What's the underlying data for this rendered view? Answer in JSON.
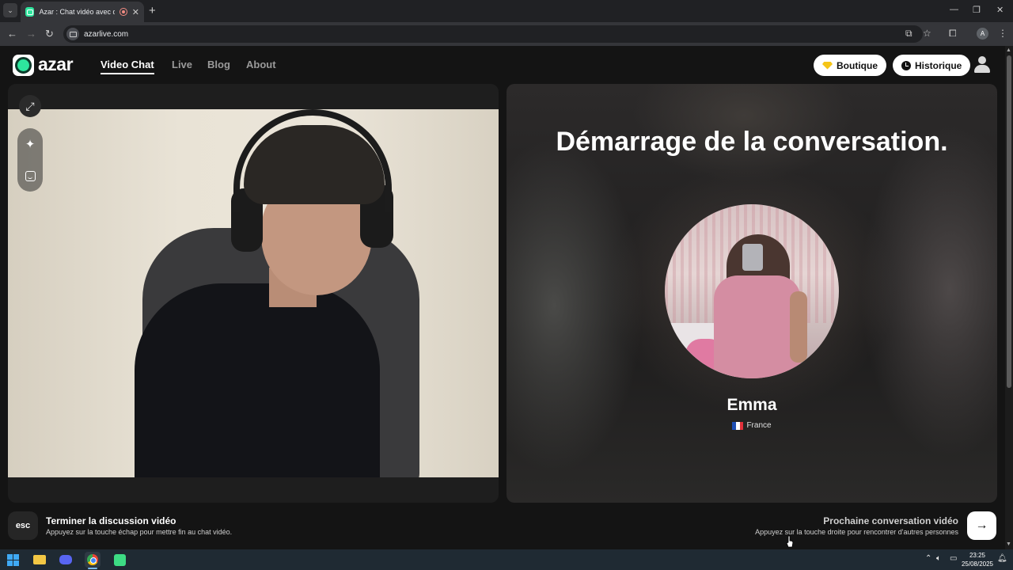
{
  "browser": {
    "tab_title": "Azar : Chat vidéo avec de nouvelles personnes",
    "url": "azarlive.com",
    "profile_initial": "A"
  },
  "header": {
    "logo_text": "azar",
    "nav": [
      "Video Chat",
      "Live",
      "Blog",
      "About"
    ],
    "active_nav": "Video Chat",
    "boutique_label": "Boutique",
    "historique_label": "Historique"
  },
  "partner": {
    "heading": "Démarrage de la conversation.",
    "name": "Emma",
    "country": "France"
  },
  "bottom": {
    "esc_key": "esc",
    "end_title": "Terminer la discussion vidéo",
    "end_desc": "Appuyez sur la touche échap pour mettre fin au chat vidéo.",
    "next_title": "Prochaine conversation vidéo",
    "next_desc": "Appuyez sur la touche droite pour rencontrer d'autres personnes"
  },
  "taskbar": {
    "time": "23:25",
    "date": "25/08/2025",
    "apps": [
      "start-icon",
      "file-explorer-icon",
      "discord-icon",
      "chrome-icon",
      "app-icon"
    ]
  },
  "colors": {
    "brand_green": "#2ee59d",
    "boutique_gem": "#f5c518",
    "page_bg": "#141414"
  }
}
